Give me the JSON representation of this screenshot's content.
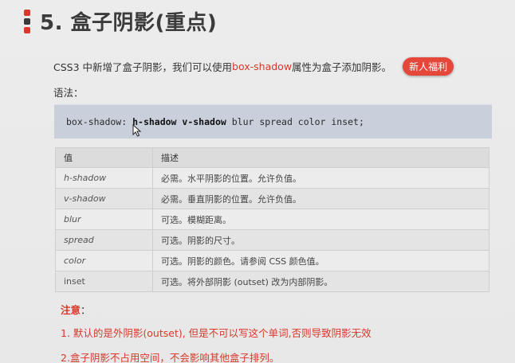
{
  "heading": {
    "title": "5. 盒子阴影(重点)",
    "mark_colors": [
      "#d9382b",
      "#3b3b3b",
      "#d9382b"
    ]
  },
  "intro": {
    "before": "CSS3 中新增了盒子阴影，我们可以使用",
    "highlight": "box-shadow",
    "after": "属性为盒子添加阴影。",
    "badge": "新人福利"
  },
  "syntax_label": "语法：",
  "code": {
    "prefix": "box-shadow: ",
    "bold": "h-shadow v-shadow",
    "rest": " blur spread color inset;"
  },
  "table": {
    "headers": [
      "值",
      "描述"
    ],
    "rows": [
      {
        "value": "h-shadow",
        "desc": "必需。水平阴影的位置。允许负值。"
      },
      {
        "value": "v-shadow",
        "desc": "必需。垂直阴影的位置。允许负值。"
      },
      {
        "value": "blur",
        "desc": "可选。模糊距离。"
      },
      {
        "value": "spread",
        "desc": "可选。阴影的尺寸。"
      },
      {
        "value": "color",
        "desc": "可选。阴影的颜色。请参阅 CSS 颜色值。"
      },
      {
        "value": "inset",
        "desc": "可选。将外部阴影 (outset) 改为内部阴影。"
      }
    ]
  },
  "notes": {
    "label": "注意",
    "colon": "：",
    "items": [
      "1. 默认的是外阴影(outset), 但是不可以写这个单词,否则导致阴影无效",
      "2.盒子阴影不占用空间，不会影响其他盒子排列。"
    ]
  },
  "colors": {
    "accent": "#d9382b",
    "code_bg": "#c9d0dc",
    "badge_bg": "#e5473b"
  }
}
